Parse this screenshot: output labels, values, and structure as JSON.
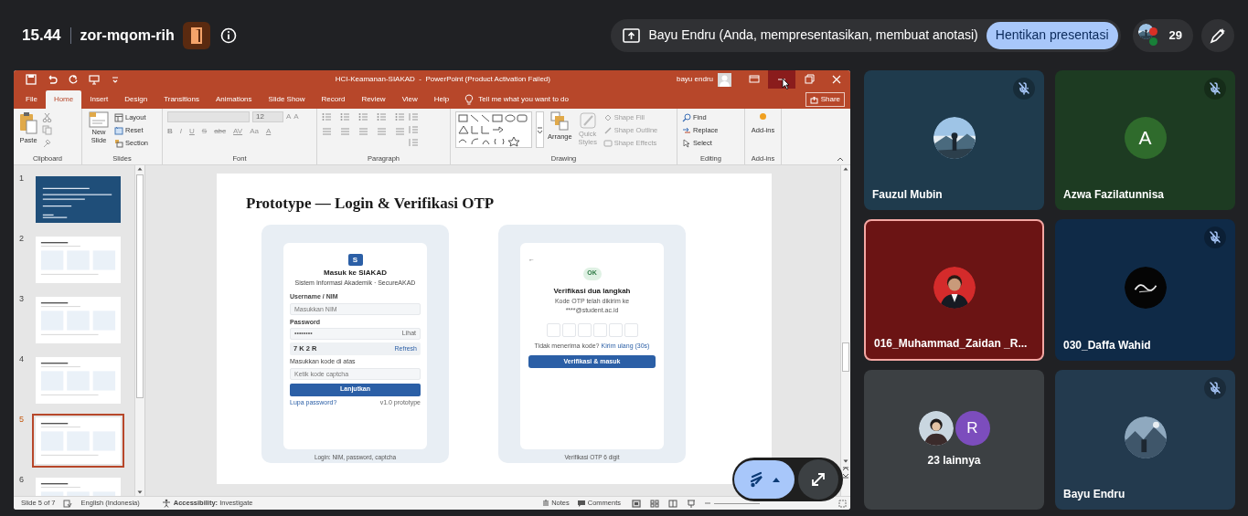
{
  "meeting_bar": {
    "time": "15.44",
    "code": "zor-mqom-rih",
    "presenter_notice": "Bayu Endru (Anda, mempresentasikan, membuat anotasi)",
    "stop_button": "Hentikan presentasi",
    "participant_count": "29"
  },
  "powerpoint": {
    "title": "HCI-Keamanan-SIAKAD  -  PowerPoint (Product Activation Failed)",
    "user": "bayu endru",
    "window_controls": [
      {
        "kind": "ribbon_options",
        "hovered": false
      },
      {
        "kind": "minimize",
        "hovered": true
      },
      {
        "kind": "restore",
        "hovered": false
      },
      {
        "kind": "close",
        "hovered": false
      }
    ],
    "tabs": [
      {
        "label": "File",
        "selected": false
      },
      {
        "label": "Home",
        "selected": true
      },
      {
        "label": "Insert",
        "selected": false
      },
      {
        "label": "Design",
        "selected": false
      },
      {
        "label": "Transitions",
        "selected": false
      },
      {
        "label": "Animations",
        "selected": false
      },
      {
        "label": "Slide Show",
        "selected": false
      },
      {
        "label": "Record",
        "selected": false
      },
      {
        "label": "Review",
        "selected": false
      },
      {
        "label": "View",
        "selected": false
      },
      {
        "label": "Help",
        "selected": false
      }
    ],
    "tell_me": "Tell me what you want to do",
    "share": "Share",
    "ribbon": {
      "clipboard": {
        "label": "Clipboard",
        "paste": "Paste"
      },
      "slides": {
        "label": "Slides",
        "new_slide": "New Slide",
        "layout": "Layout",
        "reset": "Reset",
        "section": "Section"
      },
      "font": {
        "label": "Font",
        "size": "12",
        "row1_buttons": [
          "A",
          "A"
        ],
        "row2_buttons": [
          "B",
          "I",
          "U",
          "S",
          "abc",
          "AV",
          "Aa",
          "A"
        ]
      },
      "paragraph": {
        "label": "Paragraph"
      },
      "drawing": {
        "label": "Drawing",
        "arrange": "Arrange",
        "quick_styles": "Quick Styles",
        "shape_fill": "Shape Fill",
        "shape_outline": "Shape Outline",
        "shape_effects": "Shape Effects"
      },
      "editing": {
        "label": "Editing",
        "find": "Find",
        "replace": "Replace",
        "select": "Select"
      },
      "addins": {
        "label": "Add-ins",
        "button": "Add-ins"
      }
    },
    "thumbnails": [
      {
        "number": "1",
        "kind": "title",
        "selected": false
      },
      {
        "number": "2",
        "kind": "content",
        "selected": false
      },
      {
        "number": "3",
        "kind": "content",
        "selected": false
      },
      {
        "number": "4",
        "kind": "content",
        "selected": false
      },
      {
        "number": "5",
        "kind": "content",
        "selected": true
      },
      {
        "number": "6",
        "kind": "content",
        "selected": false
      }
    ],
    "slide": {
      "title": "Prototype — Login & Verifikasi OTP",
      "login": {
        "logo": "S",
        "heading": "Masuk ke SIAKAD",
        "subtitle": "Sistem Informasi Akademik · SecureAKAD",
        "username_label": "Username / NIM",
        "username_placeholder": "Masukkan NIM",
        "password_label": "Password",
        "password_value": "••••••••",
        "show": "Lihat",
        "captcha": "7 K 2 R",
        "refresh": "Refresh",
        "captcha_label": "Masukkan kode di atas",
        "captcha_placeholder": "Ketik kode captcha",
        "submit": "Lanjutkan",
        "forgot": "Lupa password?",
        "version": "v1.0 prototype",
        "caption": "Login: NIM, password, captcha"
      },
      "otp": {
        "back": "←",
        "badge": "OK",
        "heading": "Verifikasi dua langkah",
        "subtitle": "Kode OTP telah dikirim ke",
        "email": "****@student.ac.id",
        "resend_prompt": "Tidak menerima kode?",
        "resend": "Kirim ulang (30s)",
        "submit": "Verifikasi & masuk",
        "caption": "Verifikasi OTP 6 digit"
      }
    },
    "status_bar": {
      "slide": "Slide 5 of 7",
      "language": "English (Indonesia)",
      "accessibility": "**Accessibility:** Investigate",
      "notes": "Notes",
      "comments": "Comments"
    }
  },
  "participants": [
    {
      "kind": "person",
      "name": "Fauzul Mubin",
      "avatar": {
        "kind": "picture"
      },
      "muted": true,
      "speaking": false,
      "color": "#1f3b4d"
    },
    {
      "kind": "person",
      "name": "Azwa Fazilatunnisa",
      "avatar": {
        "kind": "letter",
        "letter": "A",
        "color": "#2f6b2c"
      },
      "muted": true,
      "speaking": false,
      "color": "#1d3b22"
    },
    {
      "kind": "person",
      "name": "016_Muhammad_Zaidan _R...",
      "avatar": {
        "kind": "picture"
      },
      "muted": false,
      "speaking": true,
      "color": "#6b1414"
    },
    {
      "kind": "person",
      "name": "030_Daffa Wahid",
      "avatar": {
        "kind": "picture"
      },
      "muted": true,
      "speaking": false,
      "color": "#0f2a47"
    },
    {
      "kind": "others",
      "name": "23 lainnya",
      "avatars": [
        {
          "kind": "picture"
        },
        {
          "kind": "letter",
          "letter": "R",
          "color": "#7c4dbd"
        }
      ],
      "muted": false,
      "speaking": false,
      "color": "#3c4043"
    },
    {
      "kind": "person",
      "name": "Bayu Endru",
      "avatar": {
        "kind": "picture"
      },
      "muted": true,
      "speaking": false,
      "color": "#233a4e"
    }
  ]
}
